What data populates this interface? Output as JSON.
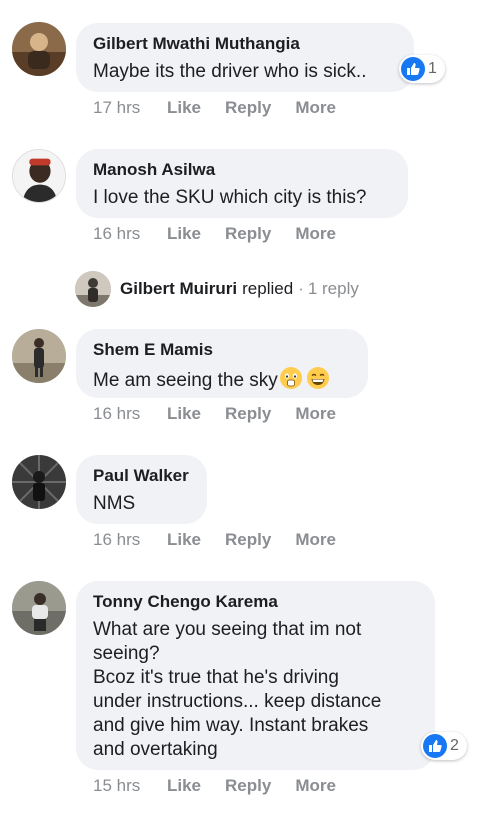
{
  "comments": [
    {
      "author": "Gilbert Mwathi Muthangia",
      "text": "Maybe its the driver who is sick..",
      "time": "17 hrs",
      "reaction_count": "1",
      "avatar_icon": "profile-photo"
    },
    {
      "author": "Manosh Asilwa",
      "text": "I love the SKU which city is this?",
      "time": "16 hrs",
      "avatar_icon": "profile-photo"
    },
    {
      "author": "Shem E Mamis",
      "text": "Me am seeing the sky",
      "emojis": [
        "astonished-face-emoji",
        "grinning-face-emoji"
      ],
      "time": "16 hrs",
      "avatar_icon": "profile-photo"
    },
    {
      "author": "Paul Walker",
      "text": "NMS",
      "time": "16 hrs",
      "avatar_icon": "profile-photo"
    },
    {
      "author": "Tonny Chengo Karema",
      "text": "What are you seeing that im not\nseeing?\nBcoz it's true that he's driving\nunder instructions... keep distance\nand give him way. Instant brakes\nand overtaking",
      "time": "15 hrs",
      "reaction_count": "2",
      "avatar_icon": "profile-photo"
    }
  ],
  "actions": {
    "like": "Like",
    "reply": "Reply",
    "more": "More"
  },
  "reply_summary": {
    "name": "Gilbert Muiruri",
    "verb": "replied",
    "separator": "·",
    "count": "1 reply"
  },
  "colors": {
    "bubble": "#f0f2f5",
    "meta_text": "#8a8d91",
    "like_blue": "#1877f2"
  }
}
